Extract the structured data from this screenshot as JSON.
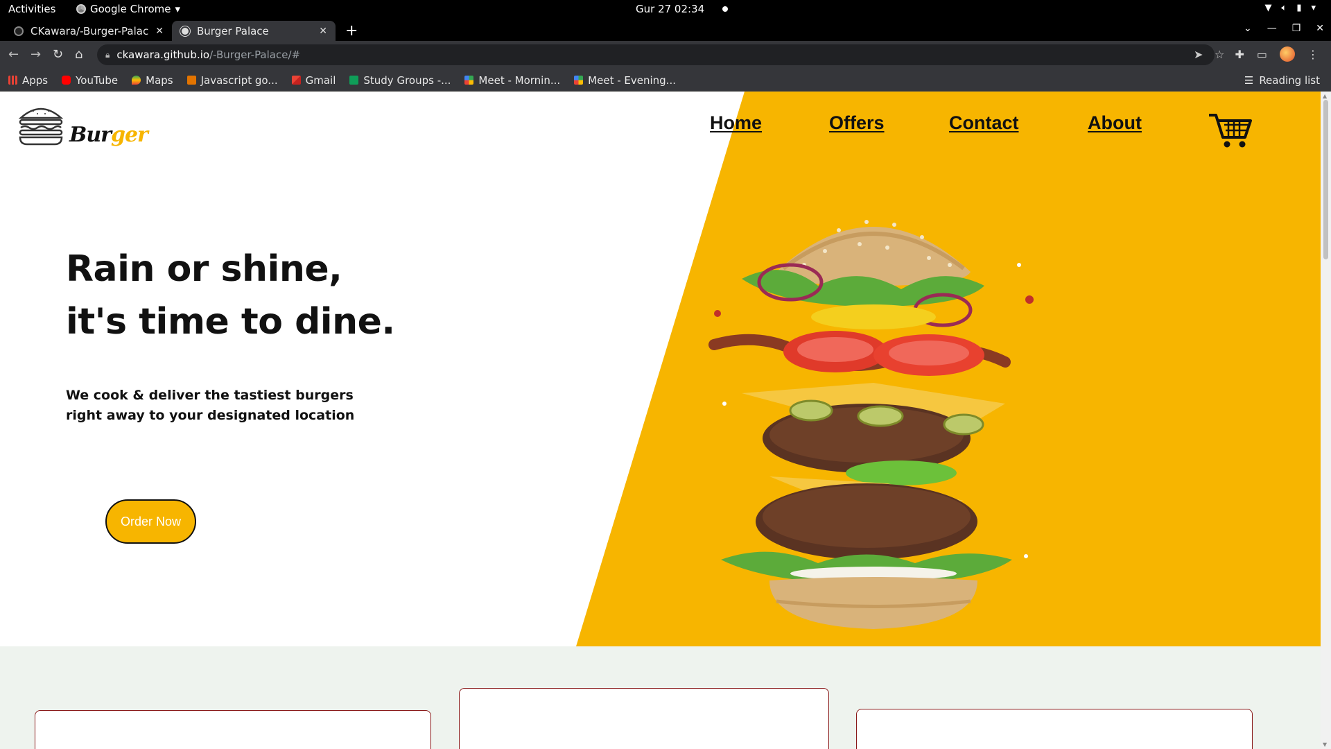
{
  "system_bar": {
    "activities": "Activities",
    "app_name": "Google Chrome",
    "clock": "Gur 27  02:34"
  },
  "browser": {
    "tabs": [
      {
        "label": "CKawara/-Burger-Palace:",
        "active": false
      },
      {
        "label": "Burger Palace",
        "active": true
      }
    ],
    "url_host": "ckawara.github.io",
    "url_path": "/-Burger-Palace/#",
    "bookmarks": [
      {
        "label": "Apps",
        "icon": "apps-grid-icon"
      },
      {
        "label": "YouTube",
        "icon": "youtube-icon"
      },
      {
        "label": "Maps",
        "icon": "maps-icon"
      },
      {
        "label": "Javascript go...",
        "icon": "bookmark-icon"
      },
      {
        "label": "Gmail",
        "icon": "gmail-icon"
      },
      {
        "label": "Study Groups -...",
        "icon": "sheets-icon"
      },
      {
        "label": "Meet - Mornin...",
        "icon": "meet-icon"
      },
      {
        "label": "Meet - Evening...",
        "icon": "meet-icon"
      }
    ],
    "reading_list": "Reading list"
  },
  "site": {
    "logo": {
      "part1": "Bur",
      "part2": "ger"
    },
    "nav": [
      "Home",
      "Offers",
      "Contact",
      "About"
    ],
    "headline_line1": "Rain or shine,",
    "headline_line2": "it's time to dine.",
    "tagline_line1": "We cook & deliver the tastiest burgers",
    "tagline_line2": "right away to your designated location",
    "cta": "Order Now",
    "colors": {
      "accent": "#f7b500",
      "text": "#111111",
      "lower_bg": "#eef3ee",
      "card_border": "#8a1a1a"
    }
  }
}
